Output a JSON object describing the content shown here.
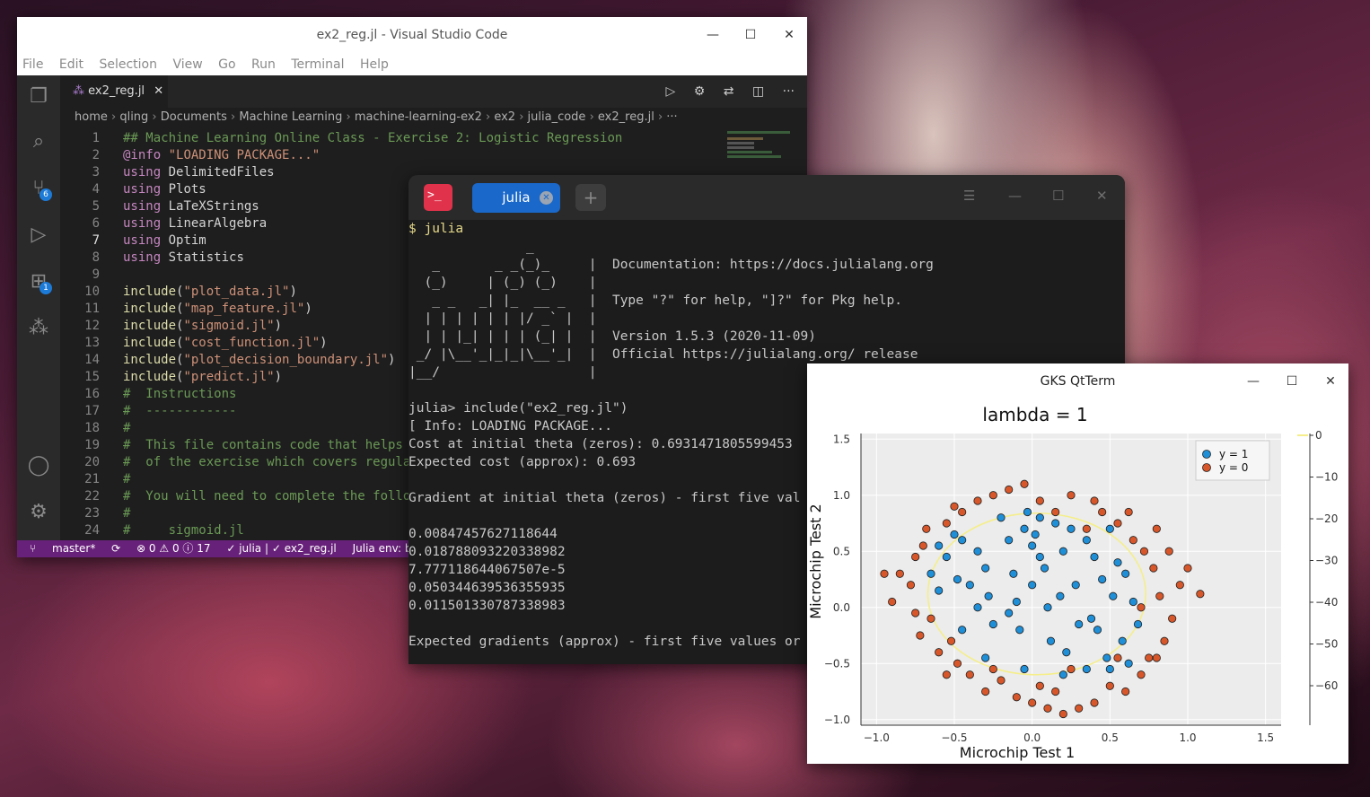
{
  "vscode": {
    "title": "ex2_reg.jl - Visual Studio Code",
    "menu": [
      "File",
      "Edit",
      "Selection",
      "View",
      "Go",
      "Run",
      "Terminal",
      "Help"
    ],
    "tab_label": "ex2_reg.jl",
    "activity_badges": {
      "source_control": "6",
      "extensions": "1"
    },
    "breadcrumbs": [
      "home",
      "qling",
      "Documents",
      "Machine Learning",
      "machine-learning-ex2",
      "ex2",
      "julia_code",
      "ex2_reg.jl",
      "···"
    ],
    "lines": [
      {
        "n": "1",
        "t": "## Machine Learning Online Class - Exercise 2: Logistic Regression"
      },
      {
        "n": "2",
        "t": "@info \"LOADING PACKAGE...\""
      },
      {
        "n": "3",
        "t": "using DelimitedFiles"
      },
      {
        "n": "4",
        "t": "using Plots"
      },
      {
        "n": "5",
        "t": "using LaTeXStrings"
      },
      {
        "n": "6",
        "t": "using LinearAlgebra"
      },
      {
        "n": "7",
        "t": "using Optim"
      },
      {
        "n": "8",
        "t": "using Statistics"
      },
      {
        "n": "9",
        "t": ""
      },
      {
        "n": "10",
        "t": "include(\"plot_data.jl\")"
      },
      {
        "n": "11",
        "t": "include(\"map_feature.jl\")"
      },
      {
        "n": "12",
        "t": "include(\"sigmoid.jl\")"
      },
      {
        "n": "13",
        "t": "include(\"cost_function.jl\")"
      },
      {
        "n": "14",
        "t": "include(\"plot_decision_boundary.jl\")"
      },
      {
        "n": "15",
        "t": "include(\"predict.jl\")"
      },
      {
        "n": "16",
        "t": "#  Instructions"
      },
      {
        "n": "17",
        "t": "#  ------------"
      },
      {
        "n": "18",
        "t": "#"
      },
      {
        "n": "19",
        "t": "#  This file contains code that helps"
      },
      {
        "n": "20",
        "t": "#  of the exercise which covers regula"
      },
      {
        "n": "21",
        "t": "#"
      },
      {
        "n": "22",
        "t": "#  You will need to complete the follo"
      },
      {
        "n": "23",
        "t": "#"
      },
      {
        "n": "24",
        "t": "#     sigmoid.jl"
      }
    ],
    "status": {
      "branch": "master*",
      "problems": "⊗ 0 ⚠ 0 ⓘ 17",
      "julia": "✓ julia | ✓ ex2_reg.jl",
      "env": "Julia env: bin"
    }
  },
  "terminal": {
    "tab_label": "julia",
    "lines": [
      "$ julia",
      "               _",
      "   _       _ _(_)_     |  Documentation: https://docs.julialang.org",
      "  (_)     | (_) (_)    |",
      "   _ _   _| |_  __ _   |  Type \"?\" for help, \"]?\" for Pkg help.",
      "  | | | | | | |/ _` |  |",
      "  | | |_| | | | (_| |  |  Version 1.5.3 (2020-11-09)",
      " _/ |\\__'_|_|_|\\__'_|  |  Official https://julialang.org/ release",
      "|__/                   |",
      "",
      "julia> include(\"ex2_reg.jl\")",
      "[ Info: LOADING PACKAGE...",
      "Cost at initial theta (zeros): 0.6931471805599453",
      "Expected cost (approx): 0.693",
      "",
      "Gradient at initial theta (zeros) - first five val",
      "",
      "0.00847457627118644",
      "0.018788093220338982",
      "7.777118644067507e-5",
      "0.050344639536355935",
      "0.011501330787338983",
      "",
      "Expected gradients (approx) - first five values or"
    ]
  },
  "gks": {
    "title": "GKS QtTerm",
    "chart_data": {
      "type": "scatter",
      "title": "lambda = 1",
      "xlabel": "Microchip Test 1",
      "ylabel": "Microchip Test 2",
      "xlim": [
        -1.1,
        1.6
      ],
      "ylim": [
        -1.05,
        1.55
      ],
      "xticks": [
        "−1.0",
        "−0.5",
        "0.0",
        "0.5",
        "1.0",
        "1.5"
      ],
      "yticks": [
        "1.5",
        "1.0",
        "0.5",
        "0.0",
        "−0.5",
        "−1.0"
      ],
      "colorbar_ticks": [
        "0",
        "−10",
        "−20",
        "−30",
        "−40",
        "−50",
        "−60"
      ],
      "legend_position": "top-right",
      "series": [
        {
          "name": "y = 1",
          "color": "#1f8fd8",
          "points": [
            [
              -0.6,
              0.15
            ],
            [
              -0.65,
              0.3
            ],
            [
              -0.6,
              0.55
            ],
            [
              -0.55,
              0.45
            ],
            [
              -0.5,
              0.65
            ],
            [
              -0.48,
              0.25
            ],
            [
              -0.45,
              0.6
            ],
            [
              -0.4,
              0.2
            ],
            [
              -0.35,
              0.5
            ],
            [
              -0.3,
              0.35
            ],
            [
              -0.28,
              0.1
            ],
            [
              -0.25,
              -0.15
            ],
            [
              -0.2,
              0.8
            ],
            [
              -0.15,
              0.6
            ],
            [
              -0.12,
              0.3
            ],
            [
              -0.1,
              0.05
            ],
            [
              -0.08,
              -0.2
            ],
            [
              -0.05,
              0.7
            ],
            [
              -0.03,
              0.85
            ],
            [
              0.0,
              0.55
            ],
            [
              0.02,
              0.65
            ],
            [
              0.05,
              0.8
            ],
            [
              0.08,
              0.35
            ],
            [
              0.1,
              0.0
            ],
            [
              0.12,
              -0.3
            ],
            [
              0.15,
              0.75
            ],
            [
              0.18,
              0.1
            ],
            [
              0.2,
              0.5
            ],
            [
              0.22,
              -0.4
            ],
            [
              0.25,
              0.7
            ],
            [
              0.28,
              0.2
            ],
            [
              0.3,
              -0.15
            ],
            [
              0.35,
              0.6
            ],
            [
              0.38,
              -0.1
            ],
            [
              0.4,
              0.45
            ],
            [
              0.42,
              -0.2
            ],
            [
              0.45,
              0.25
            ],
            [
              0.48,
              -0.45
            ],
            [
              0.5,
              0.7
            ],
            [
              0.52,
              0.1
            ],
            [
              0.55,
              0.4
            ],
            [
              0.58,
              -0.3
            ],
            [
              0.6,
              0.3
            ],
            [
              0.62,
              -0.5
            ],
            [
              0.65,
              0.05
            ],
            [
              0.68,
              -0.15
            ],
            [
              -0.45,
              -0.2
            ],
            [
              -0.3,
              -0.45
            ],
            [
              -0.05,
              -0.55
            ],
            [
              0.2,
              -0.6
            ],
            [
              0.35,
              -0.55
            ],
            [
              0.5,
              -0.55
            ],
            [
              -0.15,
              -0.05
            ],
            [
              0.0,
              0.2
            ],
            [
              -0.35,
              0.0
            ],
            [
              0.05,
              0.45
            ]
          ]
        },
        {
          "name": "y = 0",
          "color": "#d8572a",
          "points": [
            [
              -0.85,
              0.3
            ],
            [
              -0.78,
              0.2
            ],
            [
              -0.75,
              -0.05
            ],
            [
              -0.72,
              -0.25
            ],
            [
              -0.7,
              0.55
            ],
            [
              -0.68,
              0.7
            ],
            [
              -0.65,
              -0.1
            ],
            [
              -0.6,
              -0.4
            ],
            [
              -0.55,
              0.75
            ],
            [
              -0.52,
              -0.3
            ],
            [
              -0.5,
              0.9
            ],
            [
              -0.48,
              -0.5
            ],
            [
              -0.45,
              0.85
            ],
            [
              -0.4,
              -0.6
            ],
            [
              -0.35,
              0.95
            ],
            [
              -0.3,
              -0.75
            ],
            [
              -0.25,
              1.0
            ],
            [
              -0.2,
              -0.65
            ],
            [
              -0.15,
              1.05
            ],
            [
              -0.1,
              -0.8
            ],
            [
              -0.05,
              1.1
            ],
            [
              0.0,
              -0.85
            ],
            [
              0.05,
              0.95
            ],
            [
              0.1,
              -0.9
            ],
            [
              0.15,
              0.85
            ],
            [
              0.2,
              -0.95
            ],
            [
              0.25,
              1.0
            ],
            [
              0.3,
              -0.9
            ],
            [
              0.35,
              0.7
            ],
            [
              0.4,
              -0.85
            ],
            [
              0.45,
              0.85
            ],
            [
              0.5,
              -0.7
            ],
            [
              0.55,
              0.75
            ],
            [
              0.6,
              -0.75
            ],
            [
              0.62,
              0.85
            ],
            [
              0.65,
              0.6
            ],
            [
              0.7,
              -0.6
            ],
            [
              0.72,
              0.5
            ],
            [
              0.75,
              -0.45
            ],
            [
              0.78,
              0.35
            ],
            [
              0.8,
              0.7
            ],
            [
              0.82,
              0.1
            ],
            [
              0.85,
              -0.3
            ],
            [
              0.88,
              0.5
            ],
            [
              0.9,
              -0.1
            ],
            [
              0.95,
              0.2
            ],
            [
              1.0,
              0.35
            ],
            [
              1.08,
              0.12
            ],
            [
              -0.9,
              0.05
            ],
            [
              -0.95,
              0.3
            ],
            [
              0.55,
              -0.45
            ],
            [
              0.25,
              -0.55
            ],
            [
              -0.55,
              -0.6
            ],
            [
              0.7,
              0.0
            ],
            [
              -0.75,
              0.45
            ],
            [
              0.4,
              0.95
            ],
            [
              -0.25,
              -0.55
            ],
            [
              0.05,
              -0.7
            ],
            [
              0.8,
              -0.45
            ],
            [
              0.15,
              -0.75
            ]
          ]
        }
      ],
      "boundary_color": "#f5ee8a"
    }
  }
}
